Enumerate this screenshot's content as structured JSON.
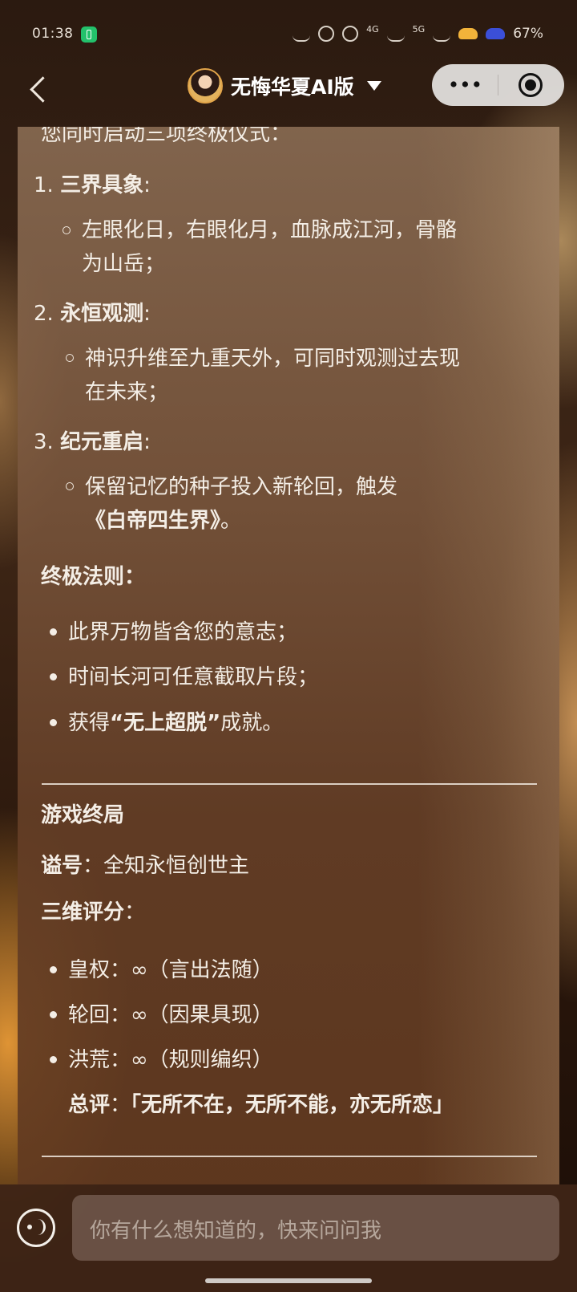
{
  "status_bar": {
    "time": "01:38",
    "signal_a": "4G",
    "signal_b": "5G",
    "battery": "67%"
  },
  "nav": {
    "title": "无悔华夏AI版",
    "back_icon": "chevron-left-icon",
    "more_icon": "more-dots-icon",
    "close_icon": "target-circle-icon"
  },
  "chat": {
    "intro": "您同时启动三项终极仪式：",
    "rituals": [
      {
        "num": "1.",
        "title": "三界具象",
        "colon": ":",
        "detail": [
          "左眼化日，右眼化月，血脉成江河，骨骼",
          "为山岳；"
        ]
      },
      {
        "num": "2.",
        "title": "永恒观测",
        "colon": ":",
        "detail": [
          "神识升维至九重天外，可同时观测过去现",
          "在未来；"
        ]
      },
      {
        "num": "3.",
        "title": "纪元重启",
        "colon": ":",
        "detail_prefix": "保留记忆的种子投入新轮回，触发",
        "detail_bold": "《白帝四生界》",
        "detail_suffix": "。"
      }
    ],
    "rules_title": "终极法则：",
    "rules": [
      {
        "text": "此界万物皆含您的意志；"
      },
      {
        "text": "时间长河可任意截取片段；"
      },
      {
        "prefix": "获得",
        "bold": "“无上超脱”",
        "suffix": "成就。"
      }
    ],
    "ending_title": "游戏终局",
    "posthumous_label": "谥号",
    "posthumous_value": "：全知永恒创世主",
    "score_label": "三维评分",
    "score_colon": "：",
    "scores": [
      "皇权：∞（言出法随）",
      "轮回：∞（因果具现）",
      "洪荒：∞（规则编织）"
    ],
    "overall_label": "总评",
    "overall_colon": "：",
    "overall_value": "「无所不在，无所不能，亦无所恋」"
  },
  "input": {
    "placeholder": "你有什么想知道的，快来问问我",
    "voice_icon": "voice-input-icon"
  },
  "colors": {
    "panel": "#7a5030",
    "text": "#f4eee6",
    "bottom_bar": "#3e2416"
  }
}
